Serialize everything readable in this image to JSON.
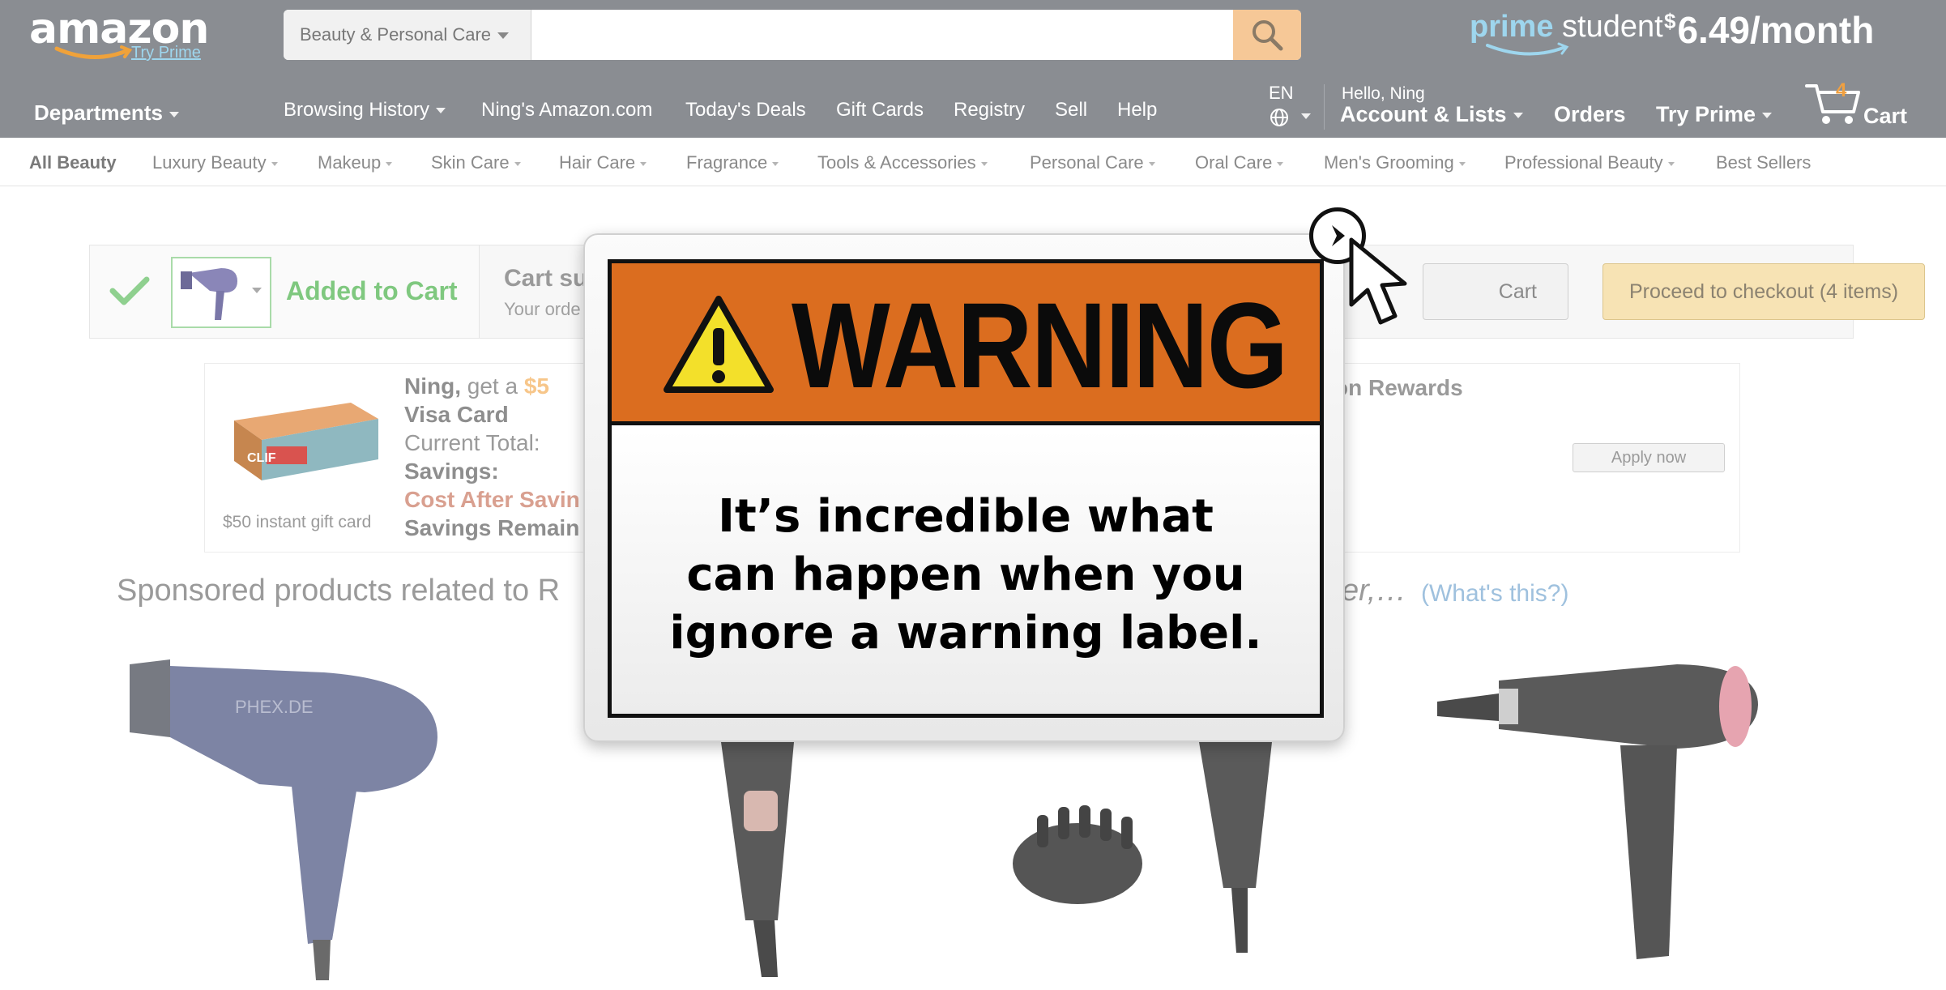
{
  "header": {
    "logo_text": "amazon",
    "logo_try_prime": "Try Prime",
    "search_category": "Beauty & Personal Care",
    "search_placeholder": "",
    "prime_word": "prime",
    "student_word": "student",
    "prime_currency": "$",
    "prime_price": "6.49/month",
    "departments": "Departments",
    "nav_links": [
      "Browsing History",
      "Ning's Amazon.com",
      "Today's Deals",
      "Gift Cards",
      "Registry",
      "Sell",
      "Help"
    ],
    "language": "EN",
    "hello": "Hello, Ning",
    "account": "Account & Lists",
    "orders": "Orders",
    "try_prime": "Try Prime",
    "cart_count": "4",
    "cart_label": "Cart"
  },
  "subnav": [
    "All Beauty",
    "Luxury Beauty",
    "Makeup",
    "Skin Care",
    "Hair Care",
    "Fragrance",
    "Tools & Accessories",
    "Personal Care",
    "Oral Care",
    "Men's Grooming",
    "Professional Beauty",
    "Best Sellers"
  ],
  "added": {
    "label": "Added to Cart",
    "summary_title": "Cart su",
    "summary_sub": "Your orde",
    "cart_button": "Cart",
    "checkout_button": "Proceed to checkout (4 items)"
  },
  "promo": {
    "line1_name": "Ning,",
    "line1_text": " get a ",
    "line1_amount": "$5",
    "line2": "Visa Card",
    "line3": "Current Total:",
    "line4": "Savings:",
    "line5": "Cost After Savin",
    "line6": "Savings Remain",
    "rewards": "zon Rewards",
    "apply": "Apply now",
    "gift_caption": "$50 instant gift card",
    "box_brand": "CLIF"
  },
  "sponsored": {
    "text": "Sponsored products related to R",
    "tail": "er,…",
    "whats_this": "(What's this?)"
  },
  "popup": {
    "title": "WARNING",
    "message_lines": [
      "It’s incredible what",
      "can happen when you",
      "ignore a warning label."
    ]
  },
  "colors": {
    "header_bg": "#8a8d92",
    "warning_orange": "#db6d1f",
    "added_green": "#7fc87f"
  }
}
